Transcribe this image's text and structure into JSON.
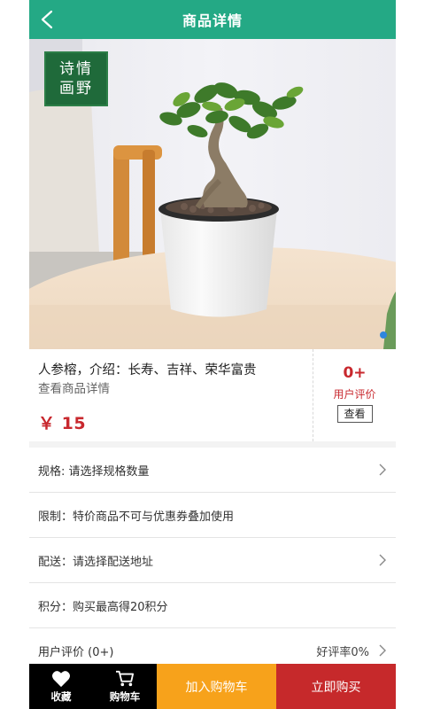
{
  "header": {
    "title": "商品详情",
    "back_icon": "chevron-left-icon",
    "background": "#24a985"
  },
  "gallery": {
    "logo_line1": "诗情",
    "logo_line2": "画野",
    "indicator_color": "#2f86e0"
  },
  "product": {
    "name": "人参榕，介绍：长寿、吉祥、荣华富贵",
    "detail_link": "查看商品详情",
    "price": "￥ 15",
    "price_color": "#c8282e"
  },
  "reviews_summary": {
    "count": "0+",
    "label": "用户评价",
    "view_button": "查看"
  },
  "rows": [
    {
      "label": "规格: 请选择规格数量",
      "extra": "",
      "chevron": true
    },
    {
      "label": "限制：特价商品不可与优惠券叠加使用",
      "extra": "",
      "chevron": false
    },
    {
      "label": "配送：请选择配送地址",
      "extra": "",
      "chevron": true
    },
    {
      "label": "积分：购买最高得20积分",
      "extra": "",
      "chevron": false
    },
    {
      "label": "用户评价 (0+)",
      "extra": "好评率0%",
      "chevron": true
    }
  ],
  "bottom_bar": {
    "favorite_label": "收藏",
    "favorite_icon": "heart-icon",
    "cart_label": "购物车",
    "cart_icon": "shopping-cart-icon",
    "add_to_cart": "加入购物车",
    "buy_now": "立即购买",
    "add_to_cart_color": "#f7a21b",
    "buy_now_color": "#c6292b"
  }
}
